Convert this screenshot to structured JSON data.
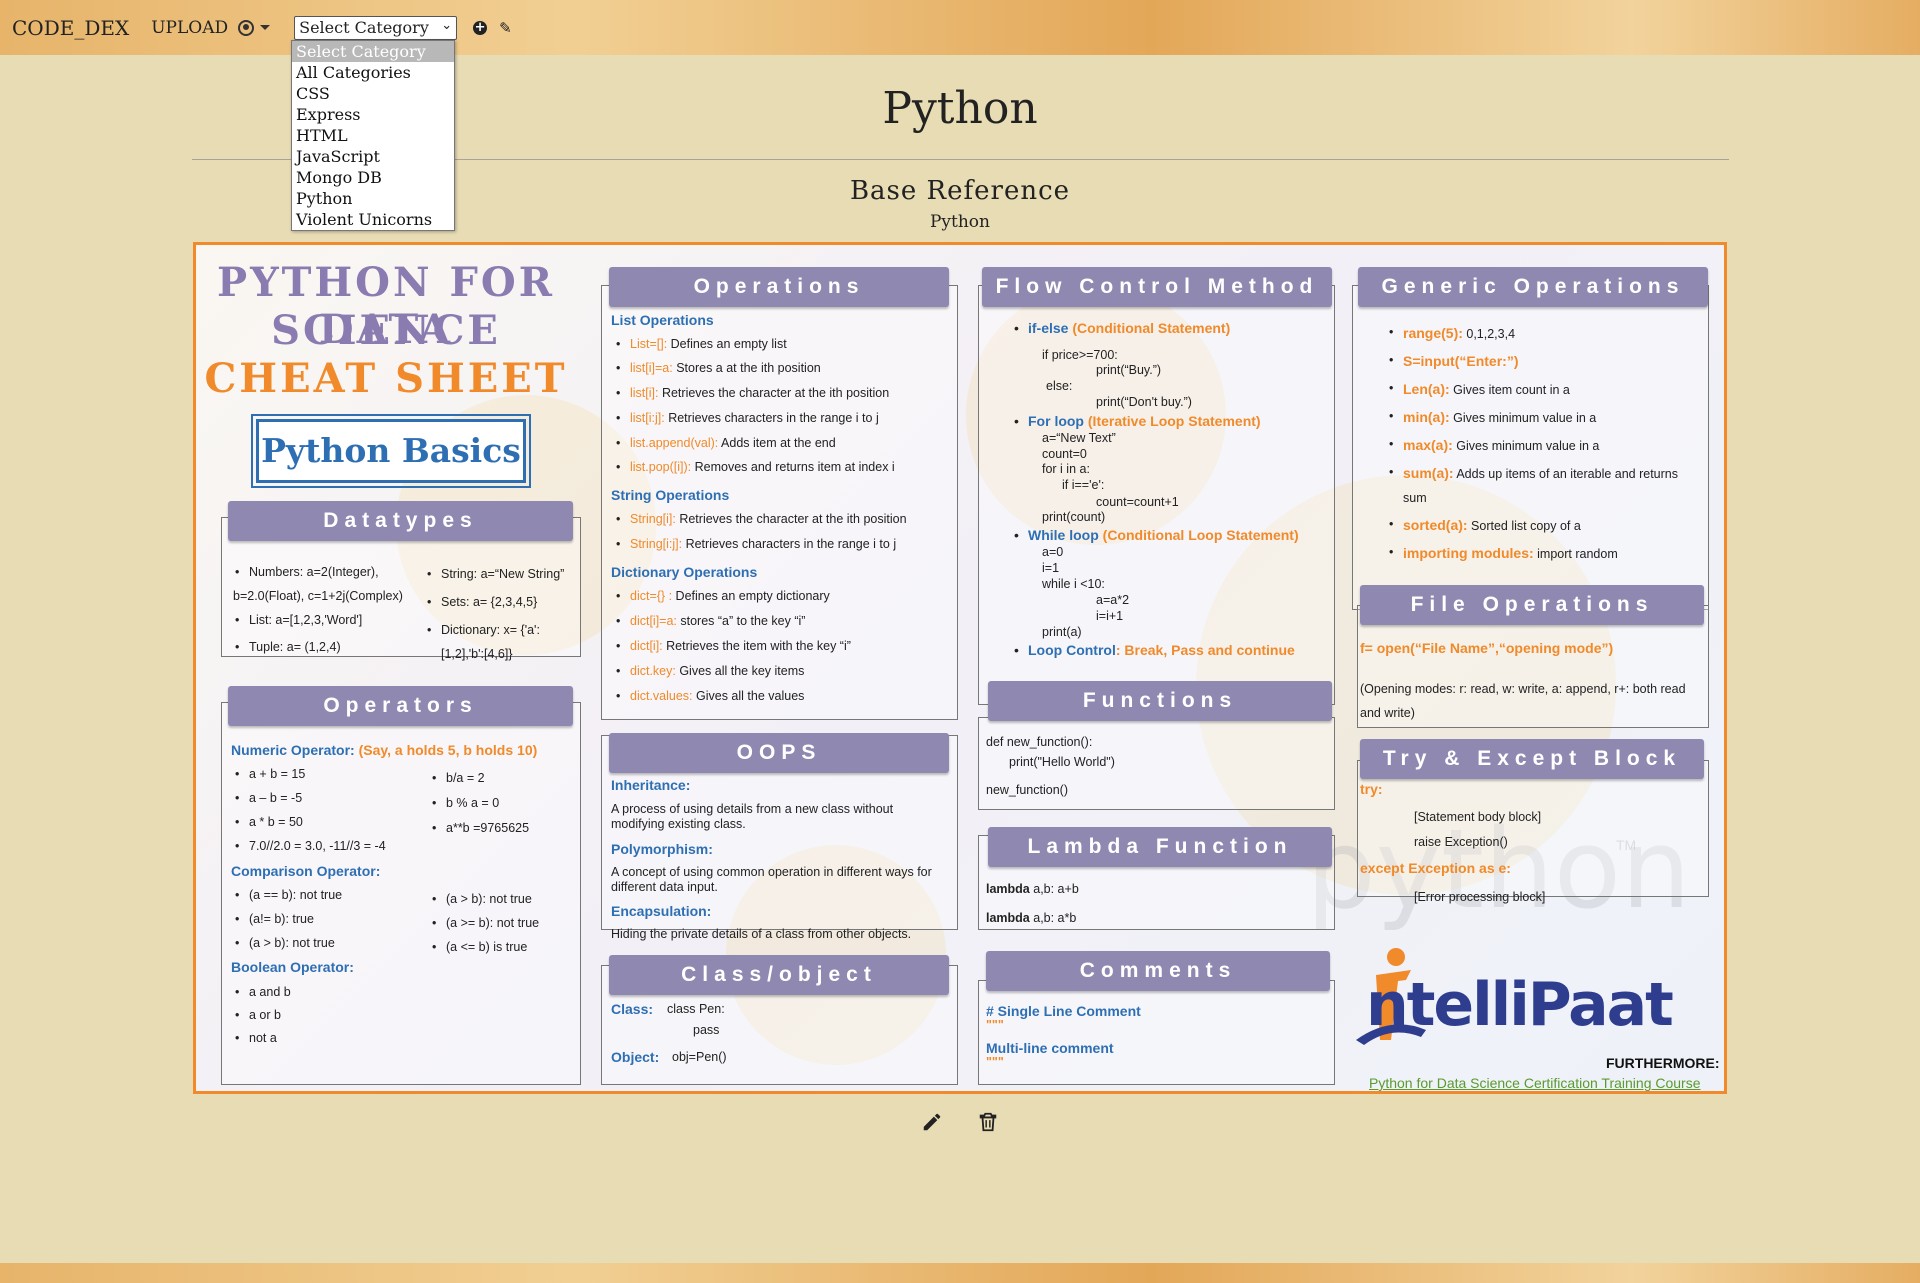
{
  "nav": {
    "brand": "CODE_DEX",
    "upload": "UPLOAD",
    "select_value": "Select Category"
  },
  "dropdown": {
    "options": [
      "Select Category",
      "All Categories",
      "CSS",
      "Express",
      "HTML",
      "JavaScript",
      "Mongo DB",
      "Python",
      "Violent Unicorns"
    ]
  },
  "page": {
    "title": "Python",
    "subtitle": "Base Reference",
    "category": "Python"
  },
  "sheet": {
    "title_line1": "PYTHON FOR DATA",
    "title_line2": "SCIENCE",
    "title_line3": "CHEAT SHEET",
    "badge": "Python Basics",
    "datatypes": {
      "header": "Datatypes",
      "l1": "Numbers: a=2(Integer),",
      "l2": "b=2.0(Float), c=1+2j(Complex)",
      "l3": "List: a=[1,2,3,'Word']",
      "l4": "Tuple: a= (1,2,4)",
      "r1": "String: a=“New String”",
      "r2": "Sets: a= {2,3,4,5}",
      "r3": "Dictionary: x= {'a':",
      "r4": "[1,2],'b':[4,6]}"
    },
    "operators": {
      "header": "Operators",
      "numeric_label": "Numeric Operator:",
      "numeric_note": "(Say, a holds 5, b holds 10)",
      "n1": "a + b = 15",
      "n2": "a – b = -5",
      "n3": "a * b = 50",
      "n4": "7.0//2.0 = 3.0, -11//3 = -4",
      "n5": "b/a = 2",
      "n6": "b % a = 0",
      "n7": "a**b =9765625",
      "comparison_label": "Comparison Operator:",
      "c1": "(a == b): not true",
      "c2": "(a!= b): true",
      "c3": "(a > b): not true",
      "c4": "(a > b): not true",
      "c5": "(a >= b): not true",
      "c6": "(a <= b) is true",
      "boolean_label": "Boolean Operator:",
      "b1": "a and b",
      "b2": "a or b",
      "b3": "not a"
    },
    "operations": {
      "header": "Operations",
      "list_label": "List Operations",
      "l1k": "List=[]:",
      "l1v": " Defines an empty list",
      "l2k": "list[i]=a:",
      "l2v": " Stores a at the ith position",
      "l3k": "list[i]:",
      "l3v": " Retrieves the character at the ith position",
      "l4k": "list[i:j]:",
      "l4v": " Retrieves characters in the range i to j",
      "l5k": "list.append(val):",
      "l5v": " Adds item at the end",
      "l6k": "list.pop([i]):",
      "l6v": " Removes and returns item at index i",
      "string_label": "String Operations",
      "s1k": "String[i]:",
      "s1v": " Retrieves the character at the ith position",
      "s2k": "String[i:j]:",
      "s2v": " Retrieves characters in the range i to j",
      "dict_label": "Dictionary Operations",
      "d1k": "dict={} :",
      "d1v": " Defines an empty dictionary",
      "d2k": "dict[i]=a:",
      "d2v": " stores “a” to the key “i”",
      "d3k": "dict[i]:",
      "d3v": " Retrieves the item with the key “i”",
      "d4k": "dict.key:",
      "d4v": " Gives all the key items",
      "d5k": "dict.values:",
      "d5v": " Gives all the values"
    },
    "oops": {
      "header": "OOPS",
      "inh": "Inheritance:",
      "inh1": "A process of using details from a new class without",
      "inh2": "modifying existing class.",
      "poly": "Polymorphism:",
      "poly1": "A concept of using common operation in different ways for",
      "poly2": "different data input.",
      "enc": "Encapsulation:",
      "enc1": "Hiding the private details of a class from other objects."
    },
    "classobj": {
      "header": "Class/object",
      "class_label": "Class:",
      "class1": "class  Pen:",
      "class2": "pass",
      "obj_label": "Object:",
      "obj1": "obj=Pen()"
    },
    "flow": {
      "header": "Flow Control Method",
      "if_k": "if-else",
      "if_v": " (Conditional Statement)",
      "if1": "if price>=700:",
      "if2": "print(“Buy.”)",
      "if3": "else:",
      "if4": "print(“Don't buy.”)",
      "for_k": "For loop",
      "for_v": " (Iterative Loop Statement)",
      "for1": "a=“New Text”",
      "for2": "count=0",
      "for3": "for i in a:",
      "for4": "if i=='e':",
      "for5": "count=count+1",
      "for6": "print(count)",
      "wh_k": "While loop",
      "wh_v": " (Conditional Loop Statement)",
      "wh1": "a=0",
      "wh2": "i=1",
      "wh3": "while i <10:",
      "wh4": "a=a*2",
      "wh5": "i=i+1",
      "wh6": "print(a)",
      "lc_k": "Loop Control",
      "lc_v": ": Break, Pass and continue"
    },
    "functions": {
      "header": "Functions",
      "f1": "def new_function():",
      "f2": "print(\"Hello World\")",
      "f3": "new_function()"
    },
    "lambda": {
      "header": "Lambda Function",
      "l1k": "lambda",
      "l1v": " a,b: a+b",
      "l2k": "lambda",
      "l2v": " a,b: a*b"
    },
    "comments": {
      "header": "Comments",
      "c1": "# Single Line Comment",
      "c1q": "\"\"\"",
      "c2": "Multi-line comment",
      "c2q": "\"\"\""
    },
    "generic": {
      "header": "Generic Operations",
      "g1k": "range(5):",
      "g1v": " 0,1,2,3,4",
      "g2k": "S=input(“Enter:”)",
      "g3k": "Len(a):",
      "g3v": " Gives item count in a",
      "g4k": "min(a):",
      "g4v": " Gives minimum value in a",
      "g5k": "max(a):",
      "g5v": " Gives minimum value in a",
      "g6k": "sum(a):",
      "g6v": " Adds up items of an iterable and returns",
      "g6v2": "sum",
      "g7k": "sorted(a):",
      "g7v": " Sorted list copy of a",
      "g8k": "importing modules:",
      "g8v": " import random"
    },
    "file": {
      "header": "File Operations",
      "f1": "f= open(“File Name”,“opening mode”)",
      "f2": "(Opening modes: r: read, w: write, a: append, r+: both read",
      "f3": "and write)"
    },
    "tryexcept": {
      "header": "Try & Except Block",
      "t1": "try:",
      "t2": "[Statement body block]",
      "t3": "raise Exception()",
      "t4": "except Exception as e:",
      "t5": "[Error processing block]"
    },
    "watermark": "python",
    "tm": "TM",
    "logo": "ntelliPaat",
    "furthermore": "FURTHERMORE:",
    "course_link": "Python for Data Science Certification Training Course"
  },
  "colors": {
    "accent_orange": "#f08a2a",
    "accent_blue": "#2e6fb4",
    "header_purple": "#8f89b2",
    "title_purple": "#8a7bb0",
    "background": "#e8dcb5"
  }
}
